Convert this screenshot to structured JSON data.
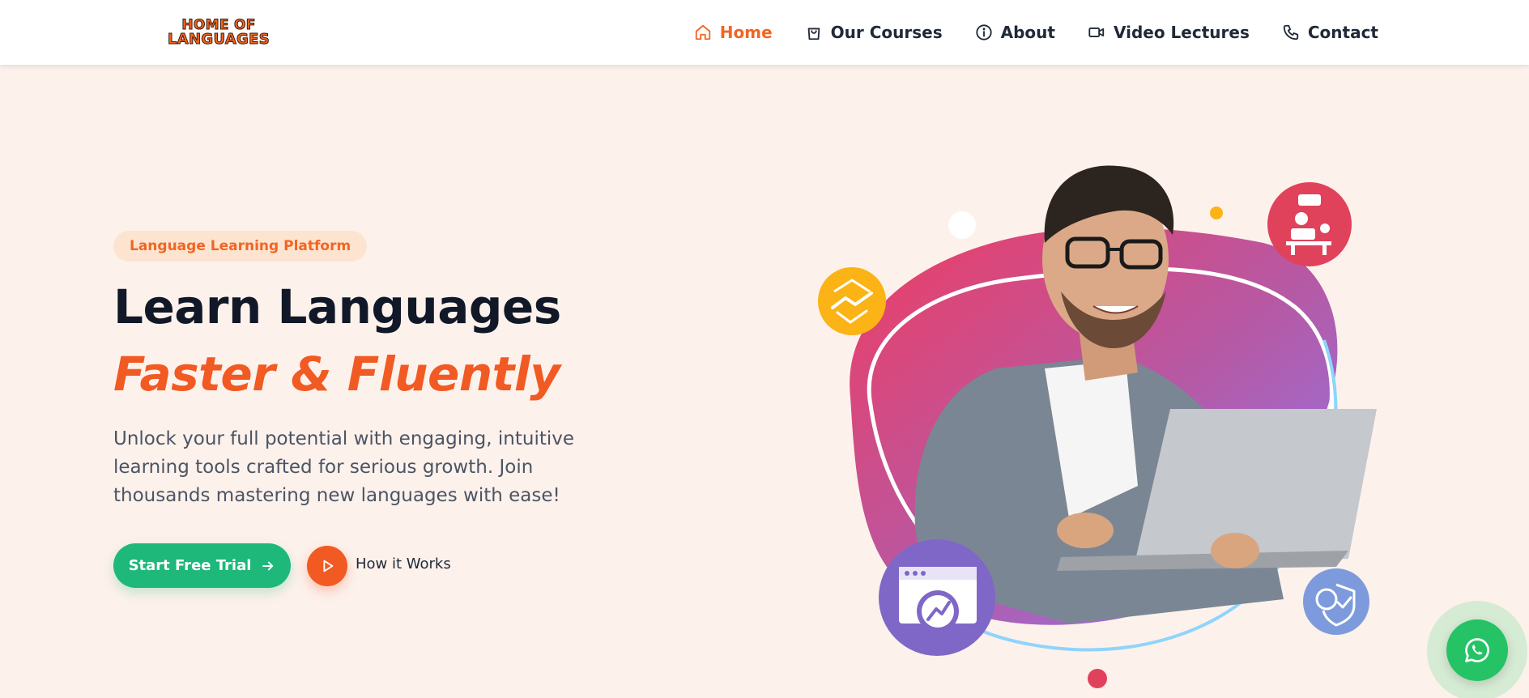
{
  "brand": {
    "logo_line1": "HOME OF",
    "logo_line2": "LANGUAGES"
  },
  "nav": {
    "items": [
      {
        "label": "Home",
        "icon": "home-icon",
        "active": true
      },
      {
        "label": "Our Courses",
        "icon": "shopping-bag-icon",
        "active": false
      },
      {
        "label": "About",
        "icon": "info-icon",
        "active": false
      },
      {
        "label": "Video Lectures",
        "icon": "video-camera-icon",
        "active": false
      },
      {
        "label": "Contact",
        "icon": "phone-icon",
        "active": false
      }
    ]
  },
  "hero": {
    "badge": "Language Learning Platform",
    "title_line1": "Learn Languages",
    "title_line2": "Faster & Fluently",
    "description": "Unlock your full potential with engaging, intuitive learning tools crafted for serious growth. Join thousands mastering new languages with ease!",
    "primary_button": "Start Free Trial",
    "secondary_button": "How it Works"
  },
  "illustration": {
    "floating_icons": [
      "handshake-icon",
      "tutor-desk-icon",
      "analytics-browser-icon",
      "coin-shield-icon"
    ]
  },
  "floating_action": {
    "icon": "whatsapp-icon"
  },
  "colors": {
    "accent_orange": "#f15a22",
    "primary_green": "#1db87a",
    "hero_background": "#fdf1ec",
    "whatsapp_green": "#25c266"
  }
}
